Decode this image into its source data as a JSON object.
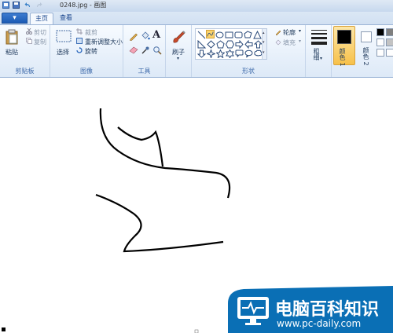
{
  "window": {
    "title": "0248.jpg - 画图"
  },
  "tabs": {
    "file": "▾",
    "home": "主页",
    "view": "查看"
  },
  "ribbon": {
    "clipboard": {
      "paste": "粘贴",
      "cut": "剪切",
      "copy": "复制",
      "group": "剪贴板"
    },
    "image": {
      "select": "选择",
      "crop": "裁剪",
      "resize": "重新调整大小",
      "rotate": "旋转",
      "group": "图像"
    },
    "tools": {
      "group": "工具"
    },
    "brushes": {
      "label": "刷子"
    },
    "shapes": {
      "outline": "轮廓",
      "fill": "填充",
      "group": "形状"
    },
    "size": {
      "label": "粗细"
    },
    "colors": {
      "color1": "颜色 1",
      "color2": "颜色 2",
      "color1_value": "#000000",
      "color2_value": "#ffffff"
    }
  },
  "watermark": {
    "brand": "电脑百科知识",
    "url": "www.pc-daily.com",
    "bg": "#0a6fb5"
  }
}
